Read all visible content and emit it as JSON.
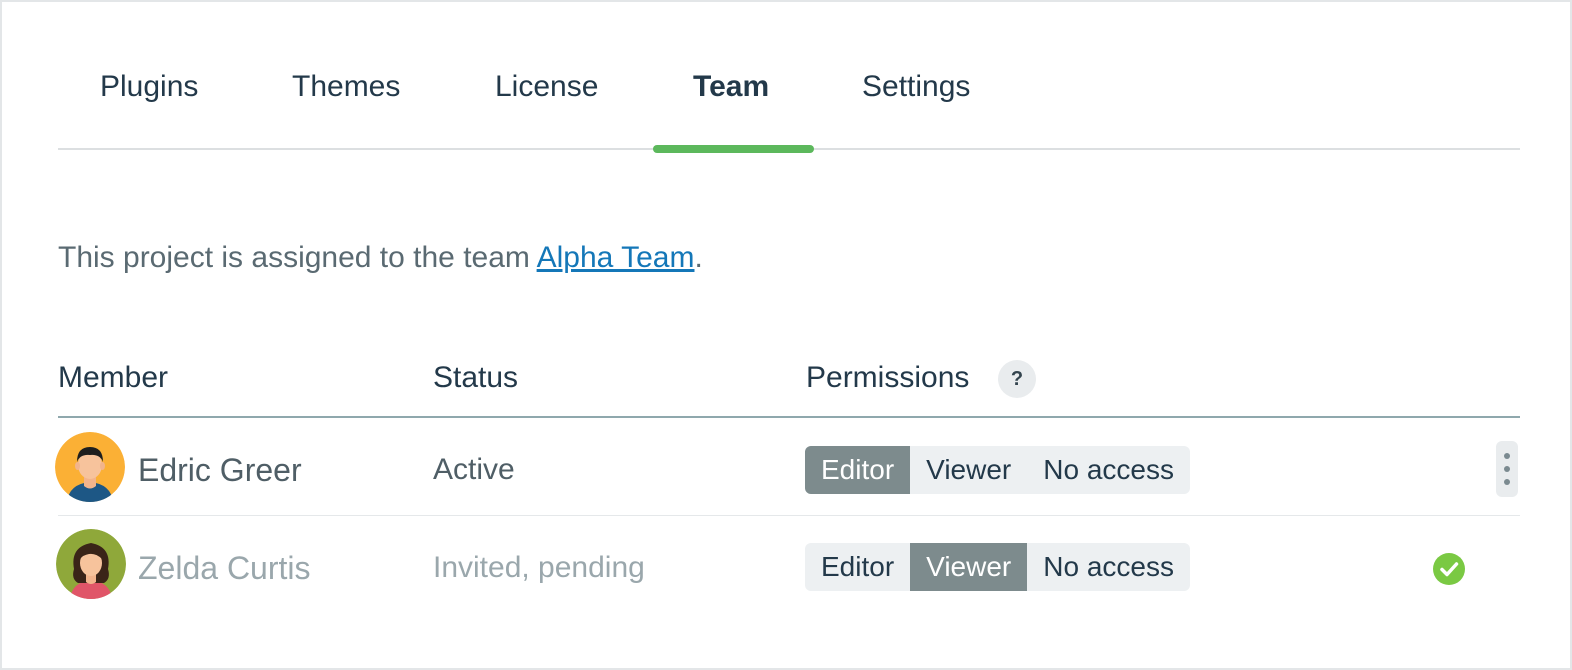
{
  "tabs": [
    {
      "label": "Plugins",
      "active": false
    },
    {
      "label": "Themes",
      "active": false
    },
    {
      "label": "License",
      "active": false
    },
    {
      "label": "Team",
      "active": true
    },
    {
      "label": "Settings",
      "active": false
    }
  ],
  "intro": {
    "text": "This project is assigned to the team ",
    "link": "Alpha Team",
    "suffix": "."
  },
  "table": {
    "headers": {
      "member": "Member",
      "status": "Status",
      "permissions": "Permissions"
    },
    "help_symbol": "?",
    "rows": [
      {
        "name": "Edric Greer",
        "status": "Active",
        "permissions": [
          "Editor",
          "Viewer",
          "No access"
        ],
        "selected_permission": "Editor",
        "avatar_bg": "#fbb035",
        "trailing": "more-button"
      },
      {
        "name": "Zelda Curtis",
        "status": "Invited, pending",
        "permissions": [
          "Editor",
          "Viewer",
          "No access"
        ],
        "selected_permission": "Viewer",
        "avatar_bg": "#8fa83a",
        "trailing": "check-icon"
      }
    ]
  },
  "colors": {
    "accent": "#5cb85c",
    "link": "#1477b8",
    "selected_segment": "#7d8b8d",
    "success": "#7ac943"
  }
}
